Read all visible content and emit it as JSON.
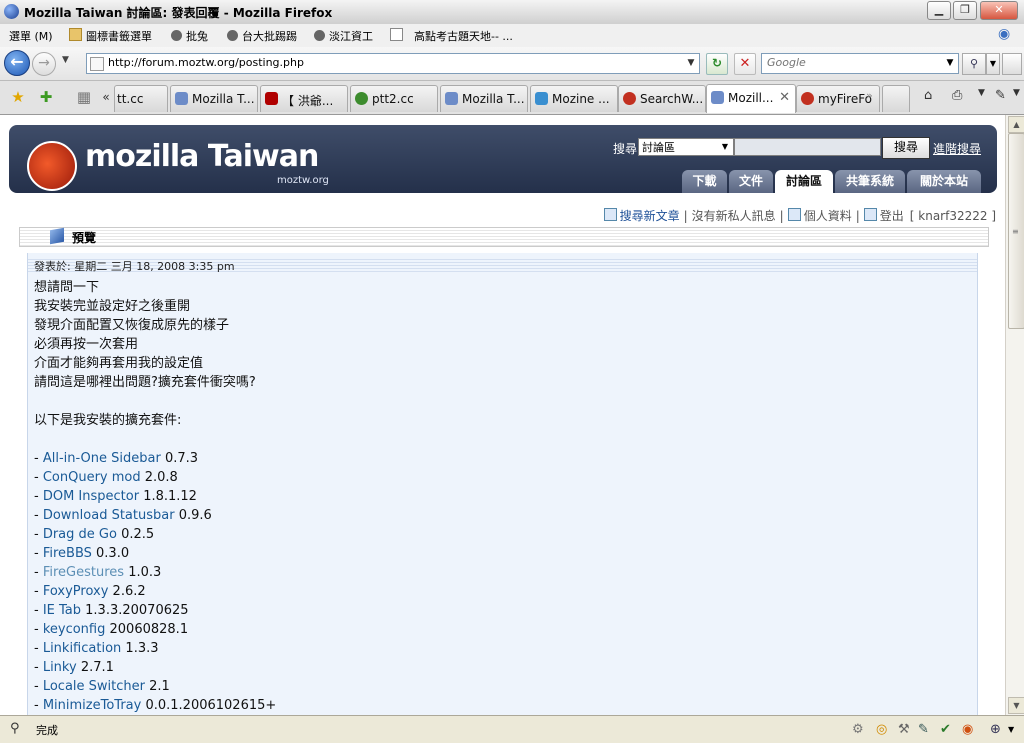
{
  "window": {
    "title": "Mozilla Taiwan 討論區: 發表回覆 - Mozilla Firefox"
  },
  "menubar": {
    "menu_label": "選單 (M)",
    "bookmarks": [
      {
        "label": "圖標書籤選單",
        "icon": "folder-icon"
      },
      {
        "label": "批兔",
        "icon": "gear-icon"
      },
      {
        "label": "台大批踢踢",
        "icon": "gear-icon"
      },
      {
        "label": "淡江資工",
        "icon": "gear-icon"
      },
      {
        "label": "",
        "icon": "page-icon"
      },
      {
        "label": "高點考古題天地-- ...",
        "icon": ""
      }
    ]
  },
  "navbar": {
    "url": "http://forum.moztw.org/posting.php",
    "search_placeholder": "Google"
  },
  "tabs": {
    "items": [
      {
        "label": "tt.cc",
        "icon_color": ""
      },
      {
        "label": "Mozilla T...",
        "icon_color": "#6d8cc8"
      },
      {
        "label": "【 洪爺...",
        "icon_color": "#b00000"
      },
      {
        "label": "ptt2.cc",
        "icon_color": "#3d8c2e"
      },
      {
        "label": "Mozilla T...",
        "icon_color": "#6d8cc8"
      },
      {
        "label": "Mozine ...",
        "icon_color": "#3a8fd0"
      },
      {
        "label": "SearchW...",
        "icon_color": "#c23020"
      },
      {
        "label": "Mozill...",
        "icon_color": "#6d8cc8"
      },
      {
        "label": "myFireFo",
        "icon_color": "#c23020"
      }
    ],
    "active_index": 7
  },
  "site": {
    "logo_text": "mozilla Taiwan",
    "logo_sub": "moztw.org",
    "search_label": "搜尋",
    "search_scope": "討論區",
    "search_button": "搜尋",
    "advanced_search": "進階搜尋",
    "nav": [
      {
        "label": "下載"
      },
      {
        "label": "文件"
      },
      {
        "label": "討論區"
      },
      {
        "label": "共筆系統"
      },
      {
        "label": "關於本站"
      }
    ],
    "active_nav_index": 2
  },
  "user_links": {
    "search_new": "搜尋新文章",
    "no_messages": "沒有新私人訊息",
    "profile": "個人資料",
    "logout": "登出",
    "username": "[ knarf32222 ]"
  },
  "preview": {
    "label": "預覽",
    "posted": "發表於: 星期二 三月 18, 2008 3:35 pm",
    "lines": [
      "想請問一下",
      "我安裝完並設定好之後重開",
      "發現介面配置又恢復成原先的樣子",
      "必須再按一次套用",
      "介面才能夠再套用我的設定值",
      "請問這是哪裡出問題?擴充套件衝突嗎?",
      "",
      "以下是我安裝的擴充套件:",
      ""
    ],
    "extensions": [
      {
        "name": "All-in-One Sidebar",
        "version": "0.7.3",
        "visited": false
      },
      {
        "name": "ConQuery mod",
        "version": "2.0.8",
        "visited": false
      },
      {
        "name": "DOM Inspector",
        "version": "1.8.1.12",
        "visited": false
      },
      {
        "name": "Download Statusbar",
        "version": "0.9.6",
        "visited": false
      },
      {
        "name": "Drag de Go",
        "version": "0.2.5",
        "visited": false
      },
      {
        "name": "FireBBS",
        "version": "0.3.0",
        "visited": false
      },
      {
        "name": "FireGestures",
        "version": "1.0.3",
        "visited": true
      },
      {
        "name": "FoxyProxy",
        "version": "2.6.2",
        "visited": false
      },
      {
        "name": "IE Tab",
        "version": "1.3.3.20070625",
        "visited": false
      },
      {
        "name": "keyconfig",
        "version": "20060828.1",
        "visited": false
      },
      {
        "name": "Linkification",
        "version": "1.3.3",
        "visited": false
      },
      {
        "name": "Linky",
        "version": "2.7.1",
        "visited": false
      },
      {
        "name": "Locale Switcher",
        "version": "2.1",
        "visited": false
      },
      {
        "name": "MinimizeToTray",
        "version": "0.0.1.2006102615+",
        "visited": false
      }
    ]
  },
  "statusbar": {
    "text": "完成"
  },
  "colors": {
    "link": "#1a5a96",
    "link_visited": "#5c8fb5",
    "banner": "#2c3854",
    "post_bg": "#eef4fc"
  }
}
